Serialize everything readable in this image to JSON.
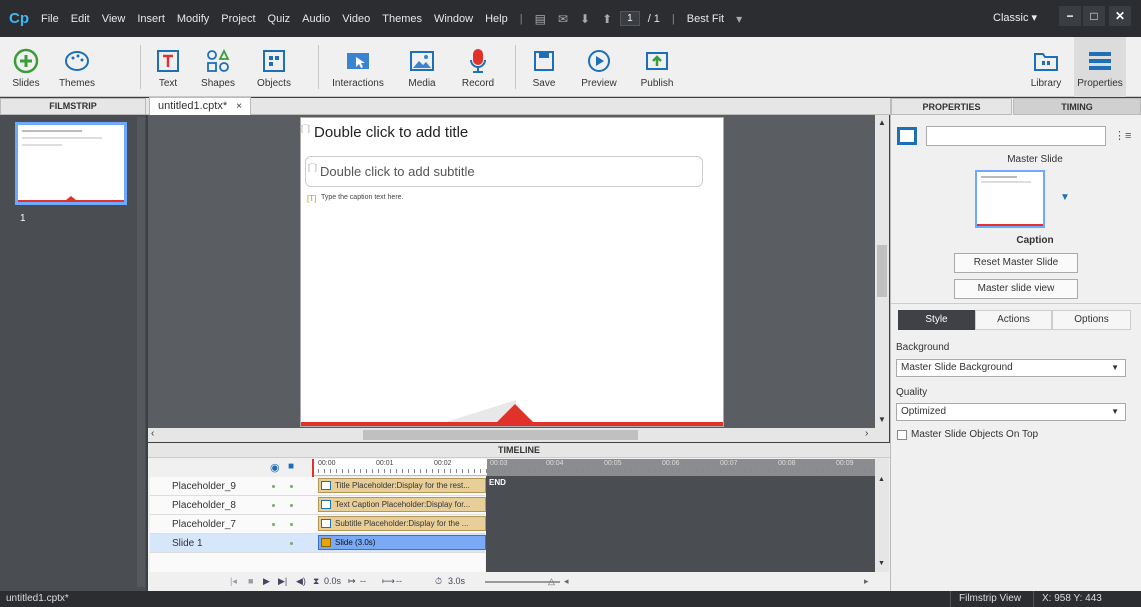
{
  "app": {
    "logo": "Cp"
  },
  "menu": [
    "File",
    "Edit",
    "View",
    "Insert",
    "Modify",
    "Project",
    "Quiz",
    "Audio",
    "Video",
    "Themes",
    "Window",
    "Help"
  ],
  "nav": {
    "current_page": "1",
    "total": "/ 1",
    "zoom": "Best Fit",
    "workspace": "Classic"
  },
  "toolbar": {
    "slides": "Slides",
    "themes": "Themes",
    "text": "Text",
    "shapes": "Shapes",
    "objects": "Objects",
    "interactions": "Interactions",
    "media": "Media",
    "record": "Record",
    "save": "Save",
    "preview": "Preview",
    "publish": "Publish",
    "library": "Library",
    "properties": "Properties"
  },
  "filmstrip": {
    "title": "FILMSTRIP",
    "slide_number": "1"
  },
  "document": {
    "tab": "untitled1.cptx*",
    "close": "×"
  },
  "slide": {
    "title": "Double click to add title",
    "subtitle": "Double click to add subtitle",
    "caption": "Type the caption text here."
  },
  "timeline": {
    "title": "TIMELINE",
    "ticks": [
      "00:00",
      "00:01",
      "00:02",
      "00:03",
      "00:04",
      "00:05",
      "00:06",
      "00:07",
      "00:08",
      "00:09"
    ],
    "end_label": "END",
    "rows": [
      {
        "name": "Placeholder_9",
        "bar": "Title Placeholder:Display for the rest..."
      },
      {
        "name": "Placeholder_8",
        "bar": "Text Caption Placeholder:Display for..."
      },
      {
        "name": "Placeholder_7",
        "bar": "Subtitle Placeholder:Display for the ..."
      },
      {
        "name": "Slide 1",
        "bar": "Slide (3.0s)"
      }
    ],
    "controls": {
      "t1": "0.0s",
      "t2": "--",
      "t3": "--",
      "t4": "3.0s"
    }
  },
  "properties": {
    "tab_properties": "PROPERTIES",
    "tab_timing": "TIMING",
    "master_slide_label": "Master Slide",
    "master_name": "Caption",
    "reset_button": "Reset Master Slide",
    "view_button": "Master slide view",
    "tabs": [
      "Style",
      "Actions",
      "Options"
    ],
    "background_label": "Background",
    "background_value": "Master Slide Background",
    "quality_label": "Quality",
    "quality_value": "Optimized",
    "objects_on_top": "Master Slide Objects On Top"
  },
  "status": {
    "file": "untitled1.cptx*",
    "view": "Filmstrip View",
    "coords": "X: 958 Y: 443"
  },
  "colors": {
    "accent": "#3fb8f0",
    "slide_selected": "#6fa8ff",
    "playhead": "#e0322a",
    "slide_bar": "#7aa9f5"
  }
}
